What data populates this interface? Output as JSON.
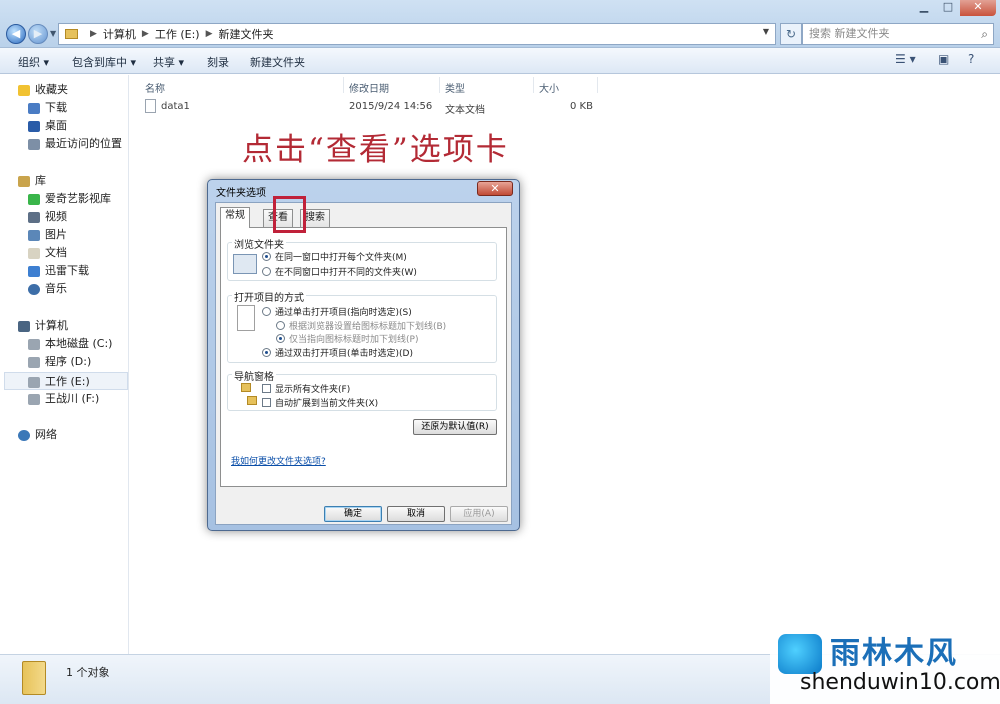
{
  "address": {
    "path": [
      "计算机",
      "工作 (E:)",
      "新建文件夹"
    ]
  },
  "search": {
    "placeholder": "搜索 新建文件夹"
  },
  "toolbar": {
    "organize": "组织 ▾",
    "include_library": "包含到库中 ▾",
    "share": "共享 ▾",
    "burn": "刻录",
    "new_folder": "新建文件夹"
  },
  "sidebar": {
    "favorites": "收藏夹",
    "favorite_items": [
      "下载",
      "桌面",
      "最近访问的位置"
    ],
    "libraries": "库",
    "library_items": [
      "爱奇艺影视库",
      "视频",
      "图片",
      "文档",
      "迅雷下载",
      "音乐"
    ],
    "computer": "计算机",
    "drives": [
      "本地磁盘 (C:)",
      "程序 (D:)",
      "工作 (E:)",
      "王战川 (F:)"
    ],
    "network": "网络"
  },
  "columns": {
    "name": "名称",
    "modified": "修改日期",
    "type": "类型",
    "size": "大小"
  },
  "files": [
    {
      "name": "data1",
      "modified": "2015/9/24 14:56",
      "type": "文本文档",
      "size": "0 KB"
    }
  ],
  "annotation": "点击“查看”选项卡",
  "dialog": {
    "title": "文件夹选项",
    "tabs": [
      "常规",
      "查看",
      "搜索"
    ],
    "browse_group": "浏览文件夹",
    "browse_same": "在同一窗口中打开每个文件夹(M)",
    "browse_new": "在不同窗口中打开不同的文件夹(W)",
    "click_group": "打开项目的方式",
    "single_click": "通过单击打开项目(指向时选定)(S)",
    "underline_browser": "根据浏览器设置给图标标题加下划线(B)",
    "underline_point": "仅当指向图标标题时加下划线(P)",
    "double_click": "通过双击打开项目(单击时选定)(D)",
    "nav_group": "导航窗格",
    "show_all_folders": "显示所有文件夹(F)",
    "auto_expand": "自动扩展到当前文件夹(X)",
    "restore_defaults": "还原为默认值(R)",
    "help_link": "我如何更改文件夹选项?",
    "ok": "确定",
    "cancel": "取消",
    "apply": "应用(A)"
  },
  "status": {
    "count": "1 个对象"
  },
  "watermark": {
    "brand": "雨林木风",
    "url": "shenduwin10.com"
  }
}
